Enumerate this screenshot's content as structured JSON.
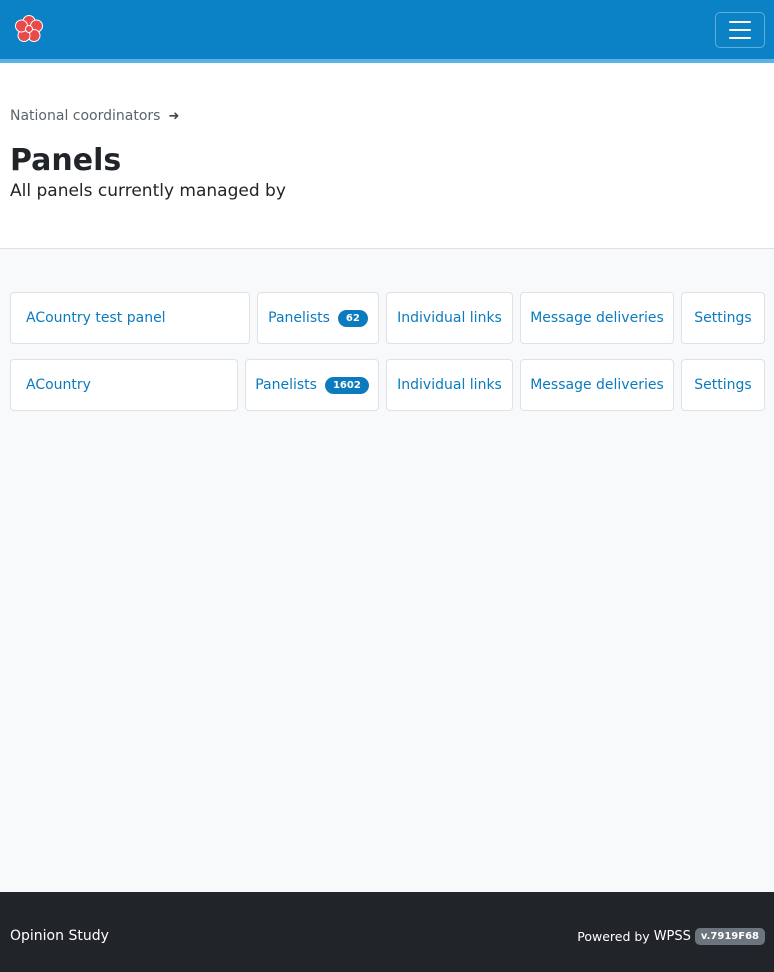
{
  "navbar": {
    "brand_color": "#0b82c5",
    "logo_icon": "red-flower-logo-icon",
    "menu_icon": "hamburger-menu-icon"
  },
  "breadcrumb": {
    "label": "National coordinators",
    "arrow": "➜"
  },
  "page": {
    "title": "Panels",
    "subtitle": "All panels currently managed by"
  },
  "panels": [
    {
      "name": "ACountry test panel",
      "panelists_label": "Panelists",
      "panelists_count": "62",
      "individual_links_label": "Individual links",
      "message_deliveries_label": "Message deliveries",
      "settings_label": "Settings"
    },
    {
      "name": "ACountry",
      "panelists_label": "Panelists",
      "panelists_count": "1602",
      "individual_links_label": "Individual links",
      "message_deliveries_label": "Message deliveries",
      "settings_label": "Settings"
    }
  ],
  "footer": {
    "brand": "Opinion Study",
    "powered_by": "Powered by",
    "wpss_link": "WPSS",
    "version": "v.7919F68"
  }
}
